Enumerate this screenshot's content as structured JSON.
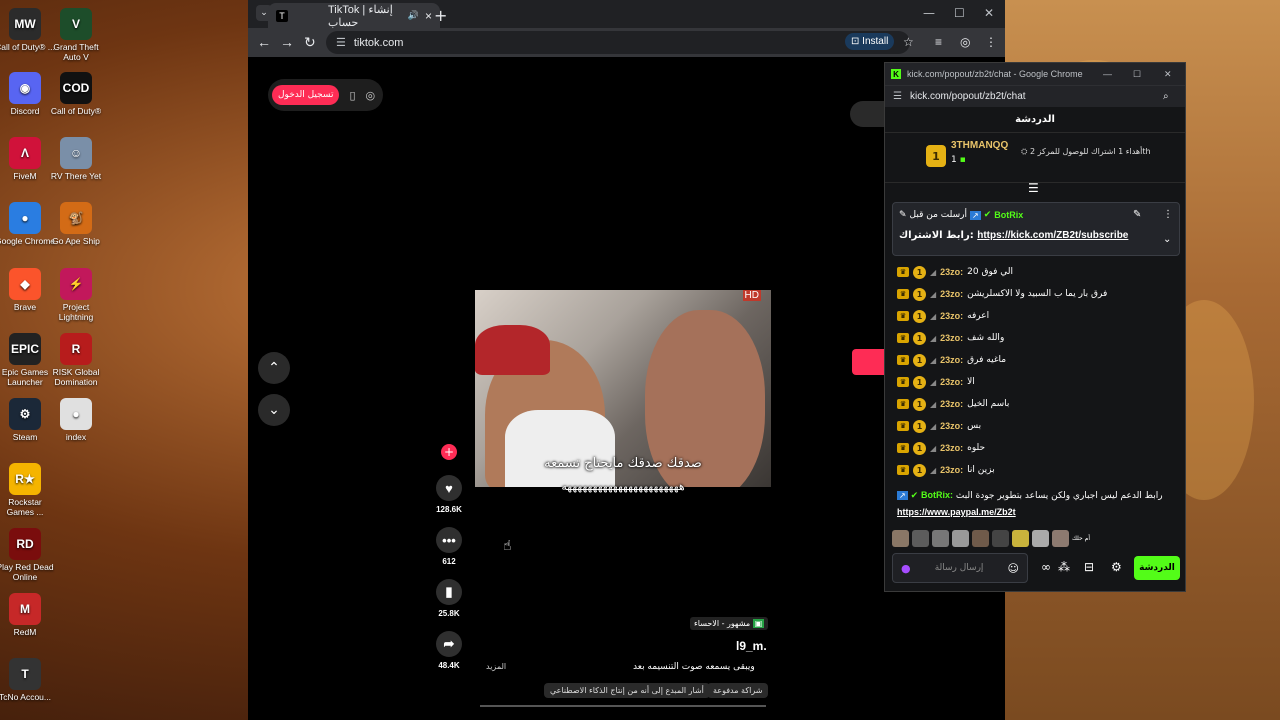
{
  "desktop": {
    "icons": [
      {
        "label": "Call of Duty® ...",
        "glyph": "MW",
        "color": "#2b2b2b"
      },
      {
        "label": "Grand Theft Auto V",
        "glyph": "V",
        "color": "#1d4d2a"
      },
      {
        "label": "Discord",
        "glyph": "◉",
        "color": "#5865f2"
      },
      {
        "label": "Call of Duty®",
        "glyph": "COD",
        "color": "#111111"
      },
      {
        "label": "FiveM",
        "glyph": "Λ",
        "color": "#d0123a"
      },
      {
        "label": "RV There Yet",
        "glyph": "☺",
        "color": "#7a8fa8"
      },
      {
        "label": "Google Chrome",
        "glyph": "●",
        "color": "#2a7de1"
      },
      {
        "label": "Go Ape Ship",
        "glyph": "🐒",
        "color": "#d36b16"
      },
      {
        "label": "Brave",
        "glyph": "◆",
        "color": "#fb542b"
      },
      {
        "label": "Project Lightning",
        "glyph": "⚡",
        "color": "#c2185b"
      },
      {
        "label": "Epic Games Launcher",
        "glyph": "EPIC",
        "color": "#222222"
      },
      {
        "label": "RISK Global Domination",
        "glyph": "R",
        "color": "#b71c1c"
      },
      {
        "label": "Steam",
        "glyph": "⚙",
        "color": "#1b2838"
      },
      {
        "label": "index",
        "glyph": "●",
        "color": "#e0e0e0"
      },
      {
        "label": "Rockstar Games ...",
        "glyph": "R★",
        "color": "#f5b400"
      },
      {
        "label": "Play Red Dead Online",
        "glyph": "RD",
        "color": "#7a0d0d"
      },
      {
        "label": "RedM",
        "glyph": "M",
        "color": "#c62828"
      },
      {
        "label": "TcNo Accou...",
        "glyph": "T",
        "color": "#333333"
      }
    ]
  },
  "browser": {
    "tab_title": "TikTok | إنشاء حساب",
    "tab_favicon": "T",
    "url": "tiktok.com",
    "install_label": "Install",
    "login_button": "تسجيل الدخول",
    "video": {
      "hd_label": "HD",
      "caption_line1": "صدقك صدقك مايحتاج تسمعه",
      "caption_line2": "هههههههههههههههههههههههه"
    },
    "actions": {
      "likes": "128.6K",
      "comments": "612",
      "saves": "25.8K",
      "shares": "48.4K"
    },
    "meta": {
      "trending_tag": "مشهور - الاحساء",
      "username": "l9_m.",
      "description": "ويبقى يسمعه صوت التنسيمه بعد",
      "more_label": "المزيد",
      "chip_paid": "شراكة مدفوعة",
      "chip_ai": "أشار المبدع إلى أنه من إنتاج الذكاء الاصطناعي"
    }
  },
  "kick": {
    "window_title": "kick.com/popout/zb2t/chat - Google Chrome",
    "url": "kick.com/popout/zb2t/chat",
    "chat_header": "الدردشة",
    "goal": {
      "rank": "1",
      "user": "3THMANQQ",
      "count": "1",
      "text": "أهداء 1 اشتراك للوصول للمركز 2",
      "suffix": "th"
    },
    "pinned": {
      "pinned_by": "أرسلت من قبل",
      "bot_name": "BotRix",
      "link_label": "رابط الاشتراك:",
      "link": "https://kick.com/ZB2t/subscribe"
    },
    "messages": [
      {
        "user": "23zo:",
        "text": "الي فوق 20"
      },
      {
        "user": "23zo:",
        "text": "فرق بار يما ب السبيد ولا الاكسلريشن"
      },
      {
        "user": "23zo:",
        "text": "اعرفه"
      },
      {
        "user": "23zo:",
        "text": "والله شف"
      },
      {
        "user": "23zo:",
        "text": "ماغيه فرق"
      },
      {
        "user": "23zo:",
        "text": "الا"
      },
      {
        "user": "23zo:",
        "text": "باسم الخيل"
      },
      {
        "user": "23zo:",
        "text": "بس"
      },
      {
        "user": "23zo:",
        "text": "حلوه"
      },
      {
        "user": "23zo:",
        "text": "بزين انا"
      }
    ],
    "bot_message": {
      "user": "BotRix:",
      "text": "رابط الدعم ليس اجباري ولكن يساعد بتطوير جودة البث",
      "link": "https://www.paypal.me/Zb2t"
    },
    "emote_more": "أم حلك",
    "input_placeholder": "إرسال رسالة",
    "send_button": "الدردشة"
  }
}
